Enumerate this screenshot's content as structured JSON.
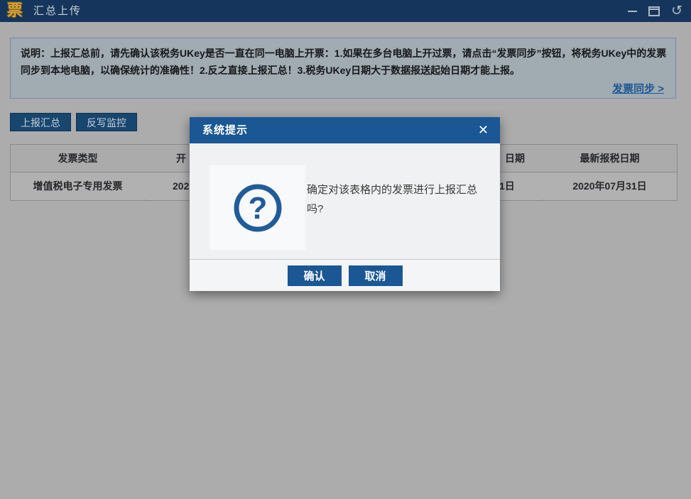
{
  "titlebar": {
    "logo": "票",
    "title": "汇总上传"
  },
  "icons": {
    "minimize": "minimize-line",
    "restore": "window-restore-outline",
    "undo": "↺",
    "dialog_close": "✕",
    "question_mark": "?"
  },
  "notice": {
    "text": "说明：上报汇总前，请先确认该税务UKey是否一直在同一电脑上开票：1.如果在多台电脑上开过票，请点击“发票同步”按钮，将税务UKey中的发票同步到本地电脑，以确保统计的准确性！2.反之直接上报汇总！3.税务UKey日期大于数据报送起始日期才能上报。",
    "sync_link": "发票同步 >"
  },
  "toolbar": {
    "report_summary": "上报汇总",
    "writeback_monitor": "反写监控"
  },
  "table": {
    "header": [
      "发票类型",
      "开",
      "日期",
      "最新报税日期"
    ],
    "row": [
      "增值税电子专用发票",
      "202",
      "1日",
      "2020年07月31日"
    ]
  },
  "dialog": {
    "title": "系统提示",
    "close": "✕",
    "message": "确定对该表格内的发票进行上报汇总吗?",
    "question_mark": "?",
    "confirm": "确认",
    "cancel": "取消"
  },
  "colors": {
    "titlebar_bg": "#16355C",
    "logo_gold": "#D9A43B",
    "page_bg": "#ACACAC",
    "notice_bg": "#A0ABB2",
    "notice_border": "#7A87A5",
    "link_blue": "#1A5794",
    "tool_button_bg": "#17466E",
    "table_border": "#8A8A8A",
    "dialog_accent": "#1A5794",
    "dialog_body_bg": "#F0F1F2",
    "icon_blue": "#1F5C99"
  }
}
